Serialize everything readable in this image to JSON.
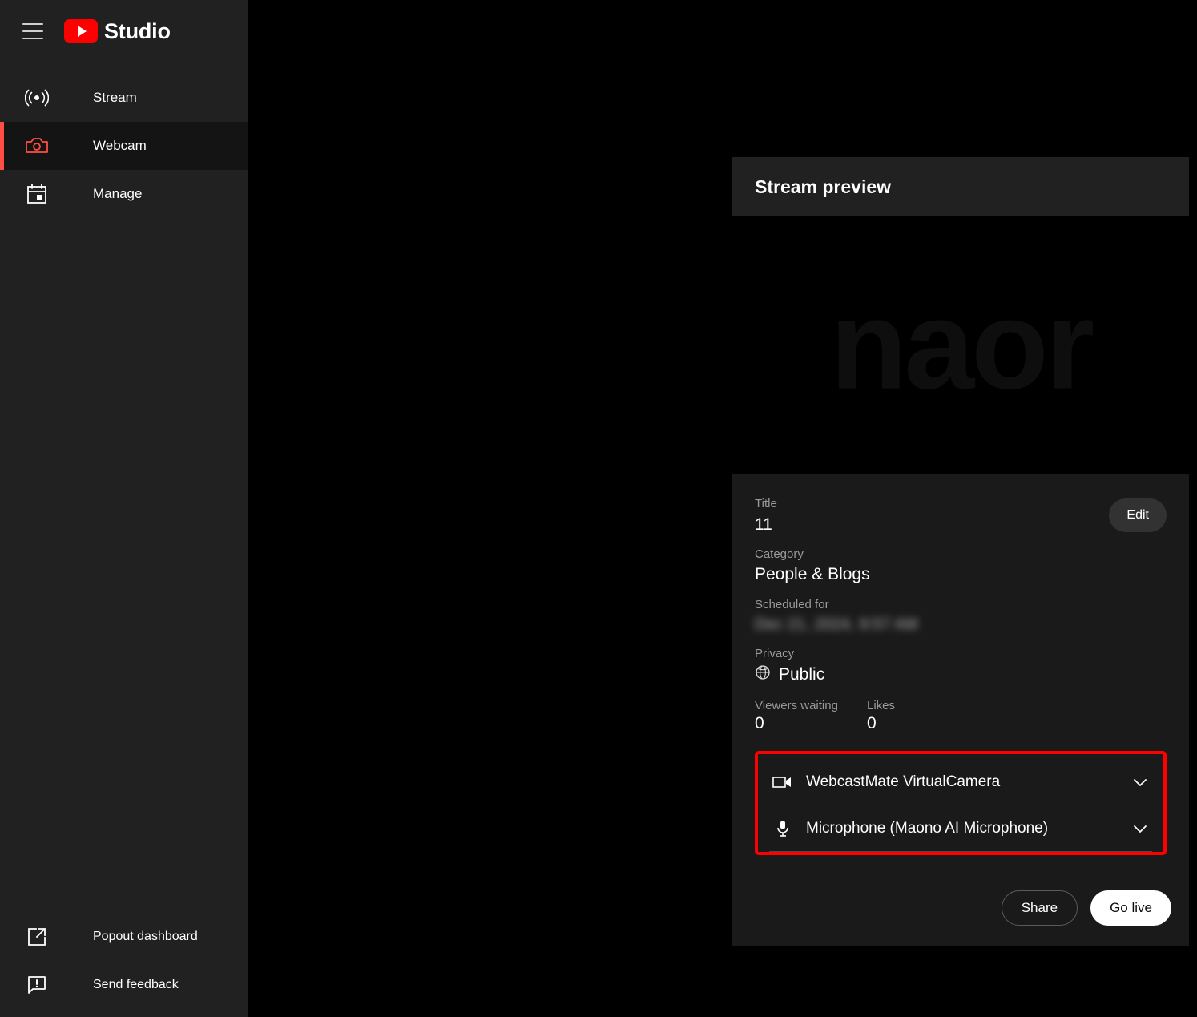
{
  "app": {
    "brand_name": "Studio",
    "menu_icon": "hamburger-icon",
    "logo_icon": "youtube-logo-icon",
    "accent_color": "#FF0000",
    "active_accent_color": "#FF4E45"
  },
  "sidebar": {
    "items": [
      {
        "label": "Stream",
        "icon": "broadcast-icon",
        "active": false
      },
      {
        "label": "Webcam",
        "icon": "camera-icon",
        "active": true
      },
      {
        "label": "Manage",
        "icon": "calendar-icon",
        "active": false
      }
    ],
    "footer_items": [
      {
        "label": "Popout dashboard",
        "icon": "open-in-new-icon"
      },
      {
        "label": "Send feedback",
        "icon": "feedback-icon"
      }
    ]
  },
  "preview": {
    "header_title": "Stream preview",
    "watermark_text": "naor"
  },
  "info": {
    "title_label": "Title",
    "title_value": "11",
    "category_label": "Category",
    "category_value": "People & Blogs",
    "scheduled_label": "Scheduled for",
    "scheduled_value": "Dec 21, 2024, 9:57 AM",
    "privacy_label": "Privacy",
    "privacy_value": "Public",
    "privacy_icon": "globe-icon",
    "edit_label": "Edit",
    "stats": [
      {
        "label": "Viewers waiting",
        "value": "0"
      },
      {
        "label": "Likes",
        "value": "0"
      }
    ]
  },
  "devices": {
    "highlight_color": "#FF0000",
    "items": [
      {
        "label": "WebcastMate VirtualCamera",
        "icon": "video-camera-icon",
        "chevron": "chevron-down-icon"
      },
      {
        "label": "Microphone (Maono AI Microphone)",
        "icon": "microphone-icon",
        "chevron": "chevron-down-icon"
      }
    ]
  },
  "actions": {
    "share_label": "Share",
    "go_live_label": "Go live"
  }
}
